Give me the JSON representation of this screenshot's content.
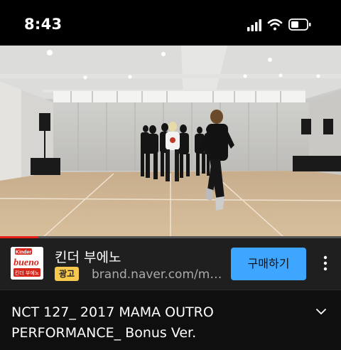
{
  "status_bar": {
    "time": "8:43",
    "icons": [
      "signal-icon",
      "wifi-icon",
      "battery-icon"
    ]
  },
  "player": {
    "progress": 0.11,
    "progress_color": "#e62117"
  },
  "ad": {
    "logo_text_top": "Kinder",
    "logo_text_main": "bueno",
    "logo_text_sub": "킨더 부에노",
    "title": "킨더 부에노",
    "badge": "광고",
    "url": "brand.naver.com/ma...",
    "cta_label": "구매하기",
    "cta_color": "#3ea6ff",
    "badge_color": "#f7c84e",
    "more_icon": "more-vertical-icon"
  },
  "video": {
    "title": "NCT 127_ 2017 MAMA OUTRO PERFORMANCE_ Bonus Ver.",
    "expand_icon": "chevron-down-icon"
  }
}
